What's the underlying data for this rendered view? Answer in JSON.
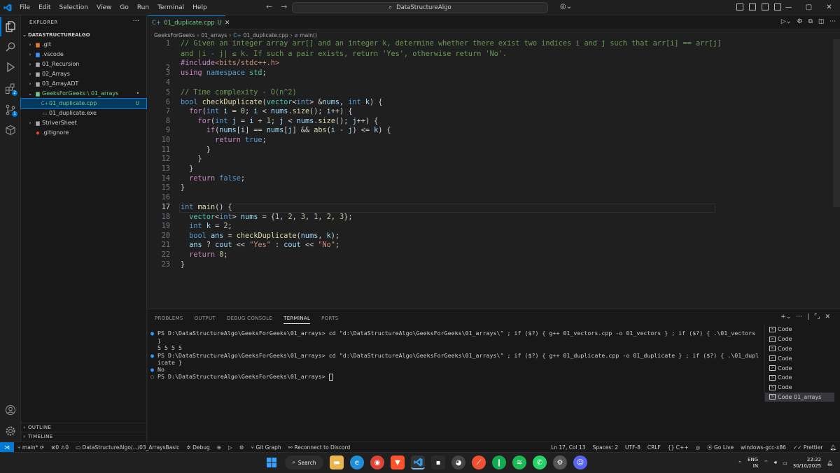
{
  "menu": [
    "File",
    "Edit",
    "Selection",
    "View",
    "Go",
    "Run",
    "Terminal",
    "Help"
  ],
  "search": {
    "text": "DataStructureAlgo"
  },
  "sidebar": {
    "title": "EXPLORER",
    "root": "DATASTRUCTUREALGO",
    "items": [
      {
        "label": ".git",
        "icon": "folder-git-icon",
        "status": ""
      },
      {
        "label": ".vscode",
        "icon": "folder-vscode-icon",
        "status": ""
      },
      {
        "label": "01_Recursion",
        "icon": "folder-icon",
        "status": ""
      },
      {
        "label": "02_Arrays",
        "icon": "folder-icon",
        "status": ""
      },
      {
        "label": "03_ArrayADT",
        "icon": "folder-icon",
        "status": ""
      },
      {
        "label": "GeeksForGeeks \\ 01_arrays",
        "icon": "folder-open-icon",
        "status": "•"
      },
      {
        "label": "01_duplicate.cpp",
        "icon": "cpp-file-icon",
        "status": "U"
      },
      {
        "label": "01_duplicate.exe",
        "icon": "exe-file-icon",
        "status": ""
      },
      {
        "label": "StriverSheet",
        "icon": "folder-icon",
        "status": ""
      },
      {
        "label": ".gitignore",
        "icon": "git-file-icon",
        "status": ""
      }
    ],
    "outline": "OUTLINE",
    "timeline": "TIMELINE"
  },
  "tab": {
    "label": "01_duplicate.cpp",
    "status": "U"
  },
  "breadcrumb": [
    "GeeksForGeeks",
    "01_arrays",
    "01_duplicate.cpp",
    "main()"
  ],
  "editor": {
    "line_numbers": [
      "1",
      "",
      "2",
      "3",
      "4",
      "5",
      "6",
      "7",
      "8",
      "9",
      "10",
      "11",
      "12",
      "13",
      "14",
      "15",
      "16",
      "17",
      "18",
      "19",
      "20",
      "21",
      "22",
      "23"
    ],
    "current_line": "17"
  },
  "panel": {
    "tabs": [
      "PROBLEMS",
      "OUTPUT",
      "DEBUG CONSOLE",
      "TERMINAL",
      "PORTS"
    ],
    "active_tab": "TERMINAL",
    "terminal_lines": [
      "PS D:\\DataStructureAlgo\\GeeksForGeeks\\01_arrays> cd \"d:\\DataStructureAlgo\\GeeksForGeeks\\01_arrays\\\" ; if ($?) { g++ 01_vectors.cpp -o 01_vectors } ; if ($?) { .\\01_vectors",
      "}",
      "5 5 5 5",
      "PS D:\\DataStructureAlgo\\GeeksForGeeks\\01_arrays> cd \"d:\\DataStructureAlgo\\GeeksForGeeks\\01_arrays\\\" ; if ($?) { g++ 01_duplicate.cpp -o 01_duplicate } ; if ($?) { .\\01_dupl",
      "icate }",
      "No",
      "PS D:\\DataStructureAlgo\\GeeksForGeeks\\01_arrays> "
    ],
    "terminals": [
      "Code",
      "Code",
      "Code",
      "Code",
      "Code",
      "Code",
      "Code",
      "Code 01_arrays"
    ]
  },
  "statusbar": {
    "branch": "main*",
    "errors": "0",
    "warnings": "0",
    "path": "DataStructureAlgo/.../03_ArraysBasic",
    "debug": "Debug",
    "gitgraph": "Git Graph",
    "discord": "Reconnect to Discord",
    "position": "Ln 17, Col 13",
    "spaces": "Spaces: 2",
    "encoding": "UTF-8",
    "eol": "CRLF",
    "language": "C++",
    "golive": "Go Live",
    "compiler": "windows-gcc-x86",
    "prettier": "Prettier"
  },
  "taskbar": {
    "search": "Search",
    "lang": "ENG",
    "region": "IN",
    "time": "22:22",
    "date": "30/10/2025"
  },
  "colors": {
    "accent": "#0078d4",
    "untracked": "#73c991",
    "editor_bg": "#1f1f1f",
    "sidebar_bg": "#181818"
  }
}
